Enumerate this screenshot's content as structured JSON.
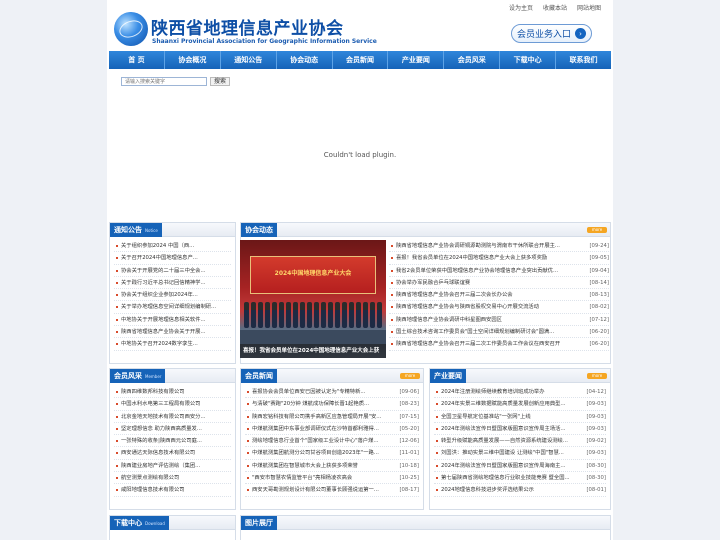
{
  "top_links": [
    "设为主页",
    "收藏本站",
    "网站地图"
  ],
  "header": {
    "title_cn": "陕西省地理信息产业协会",
    "title_en": "Shaanxi Provincial Association for Geographic Information Service",
    "member_entry": "会员业务入口"
  },
  "nav": [
    "首 页",
    "协会概况",
    "通知公告",
    "协会动态",
    "会员新闻",
    "产业要闻",
    "会员风采",
    "下载中心",
    "联系我们"
  ],
  "search": {
    "placeholder": "请输入搜索关键字",
    "button": "搜索"
  },
  "plugin_message": "Couldn't load plugin.",
  "more_label": "more",
  "notice": {
    "title": "通知公告",
    "subtitle": "Notice",
    "items": [
      "关于组织参加2024 中国（西...",
      "关于召开2024中国地理信息产...",
      "协会关于开展党的二十届三中全会...",
      "关于践行习近平总书记回信精神学...",
      "协会关于组织企业参加2024年...",
      "关于举办地理信息空间详细规划编制研...",
      "中地协关于开展地理信息相关软件...",
      "陕西省地理信息产业协会关于开展...",
      "中地协关于召开2024数字孪生..."
    ]
  },
  "dynamics": {
    "title": "协会动态",
    "photo_caption": "喜报！我省会员单位在2024中国地理信息产业大会上获",
    "banner_text": "2024中国地理信息产业大会",
    "items": [
      {
        "t": "陕西省地理信息产业协会调研铜源勘测院与渭南市干休所联合开展主...",
        "d": "[09-24]"
      },
      {
        "t": "喜报！我省会员单位在2024中国地理信息产业大会上获多项奖励",
        "d": "[09-05]"
      },
      {
        "t": "我省2会员单位荣获中国地理信息产业协会地理信息产业突出贡献优...",
        "d": "[09-04]"
      },
      {
        "t": "协会举办军民融合乒乓球联谊赛",
        "d": "[08-14]"
      },
      {
        "t": "陕西省地理信息产业协会召开三届二次会长办公会",
        "d": "[08-13]"
      },
      {
        "t": "陕西省地理信息产业协会与陕西省股权交易中心开展交流活动",
        "d": "[08-02]"
      },
      {
        "t": "陕西地理信息产业协会调研中科星图西安园区",
        "d": "[07-12]"
      },
      {
        "t": "国土综合技术咨询工作委员会\"国土空间详细规划编制研讨会\"圆满...",
        "d": "[06-20]"
      },
      {
        "t": "陕西省地理信息产业协会召开三届二次工作委员会工作会议在西安召开",
        "d": "[06-20]"
      }
    ]
  },
  "member_style": {
    "title": "会员风采",
    "subtitle": "Member",
    "items": [
      "陕西四维数邦科技有限公司",
      "中国水利水电第三工程局有限公司",
      "北京金地天地技术有限公司西安分...",
      "坚定理想信念 助力陕西高质量发...",
      "一张特殊的收条|陕西西元公司庭...",
      "西安通达天际信息技术有限公司",
      "陕西建业房地产评估测绘（集团...",
      "航空测景点测绘有限公司",
      "咸阳地理信息技术有限公司"
    ]
  },
  "member_news": {
    "title": "会员新闻",
    "items": [
      {
        "t": "喜报协会会员单位西安已因被认定为\"专精特新...",
        "d": "[09-06]"
      },
      {
        "t": "与清破\"赛跑\"20分钟 煤航成功保障长晋1起艳质...",
        "d": "[08-23]"
      },
      {
        "t": "陕西宏铭科技有限公司携手高新区应急管理局开展\"安...",
        "d": "[07-15]"
      },
      {
        "t": "中煤航测集团中东事业部调研仪式在沙特首都利雅得...",
        "d": "[05-20]"
      },
      {
        "t": "测绘地理信息行业首个\"国家级工业设计中心\"落户煤...",
        "d": "[12-06]"
      },
      {
        "t": "中煤航测集团航测分公司甘谷项目创造2023年\"一路...",
        "d": "[11-01]"
      },
      {
        "t": "中煤航测集团在智慧城市大会上获获多项荣誉",
        "d": "[10-18]"
      },
      {
        "t": "\"西安市智慧农情监管平台\"亮相杨凌农高会",
        "d": "[10-25]"
      },
      {
        "t": "西安天哥勘测规划设计有限公司董事长顾强说运第一...",
        "d": "[08-17]"
      }
    ]
  },
  "industry_news": {
    "title": "产业要闻",
    "items": [
      {
        "t": "2024年注册测绘师继续教育培训班成功举办",
        "d": "[04-12]"
      },
      {
        "t": "2024年实景三维数据赋能高质量发展创新应用典型...",
        "d": "[09-03]"
      },
      {
        "t": "全国卫星导航定位基准站\"一张网\"上线",
        "d": "[09-03]"
      },
      {
        "t": "2024年测绘法宣传日暨国家版图意识宣传周主场活...",
        "d": "[09-03]"
      },
      {
        "t": "转型升级赋能高质量发展——自然资源系统建设测绘...",
        "d": "[09-02]"
      },
      {
        "t": "刘国洪：推动实景三维中国建设 让测绘\"中国\"智慧...",
        "d": "[09-03]"
      },
      {
        "t": "2024年测绘法宣传日暨国家版图意识宣传周海南主...",
        "d": "[08-30]"
      },
      {
        "t": "第七届陕西省测绘地理信息行业职业技能竞赛 暨全国...",
        "d": "[08-30]"
      },
      {
        "t": "2024地理信息科技进步奖评选结果公示",
        "d": "[08-01]"
      }
    ]
  },
  "download": {
    "title": "下载中心",
    "subtitle": "Download"
  },
  "gallery": {
    "title": "图片展厅"
  },
  "colors": {
    "brand_blue": "#1663b8",
    "more_orange": "#f5a623",
    "bullet_red": "#d94b2b"
  }
}
